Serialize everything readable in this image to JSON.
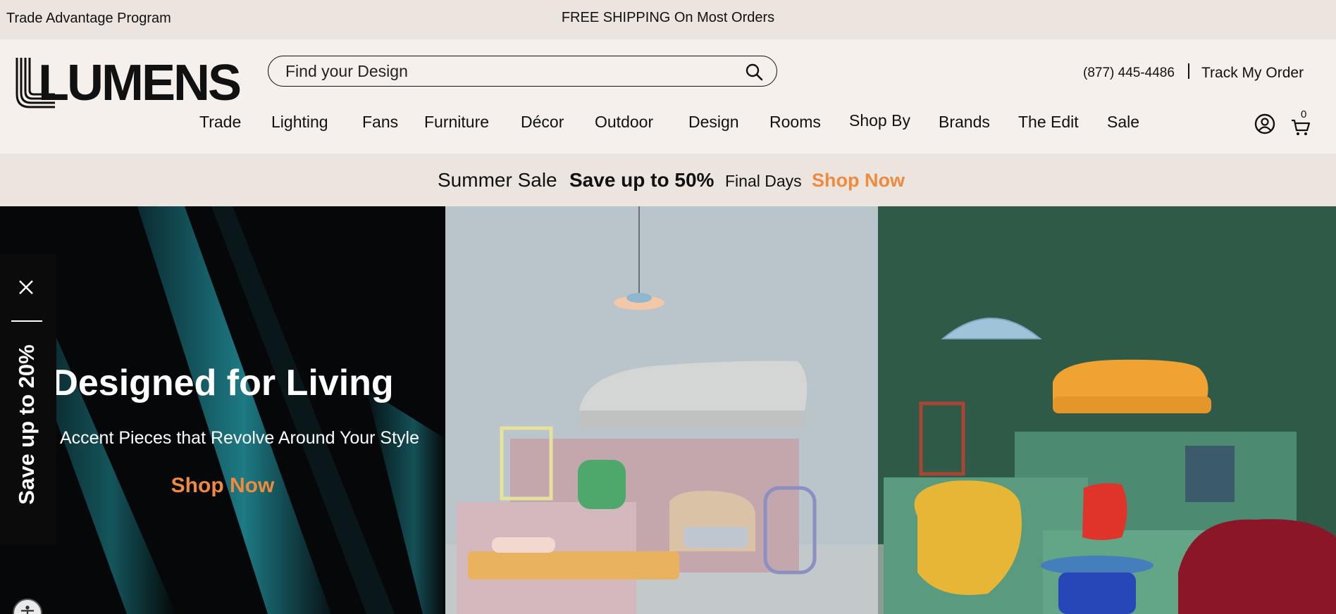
{
  "topbar": {
    "trade_program": "Trade Advantage Program",
    "shipping_text": "FREE SHIPPING On Most Orders"
  },
  "header": {
    "logo_text": "LUMENS",
    "search_placeholder": "Find your Design",
    "phone": "(877) 445-4486",
    "separator": "|",
    "track_order": "Track My Order",
    "cart_count": "0"
  },
  "nav": {
    "items": [
      "Trade",
      "Lighting",
      "Fans",
      "Furniture",
      "Décor",
      "Outdoor",
      "Design",
      "Rooms",
      "Shop By",
      "Brands",
      "The Edit",
      "Sale"
    ]
  },
  "promo": {
    "summer": "Summer Sale",
    "save": "Save up to 50%",
    "final": "Final Days",
    "cta": "Shop Now",
    "cta_color": "#f08a3c"
  },
  "hero": {
    "title": "Designed for Living",
    "subtitle": "Accent Pieces that Revolve Around Your Style",
    "cta": "Shop Now"
  },
  "side_tab": {
    "text": "Save up to 20%"
  },
  "colors": {
    "background": "#f5f0eb",
    "bar": "#ece4df",
    "accent": "#f08a3c",
    "hero_dark": "#050708",
    "hero_teal": "#1d6b74"
  }
}
